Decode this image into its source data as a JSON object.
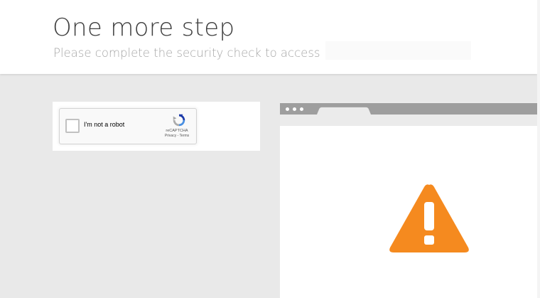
{
  "header": {
    "title": "One more step",
    "subtitle": "Please complete the security check to access"
  },
  "captcha": {
    "checkbox_label": "I'm not a robot",
    "brand": "reCAPTCHA",
    "links": "Privacy - Terms",
    "checked": false
  },
  "illustration": {
    "icon": "warning-triangle-icon",
    "icon_color": "#f58a1f",
    "chrome_color": "#9e9e9e"
  },
  "colors": {
    "page_background": "#e9e9e9",
    "title_text": "#404040",
    "subtitle_text": "#a6a6a6"
  }
}
